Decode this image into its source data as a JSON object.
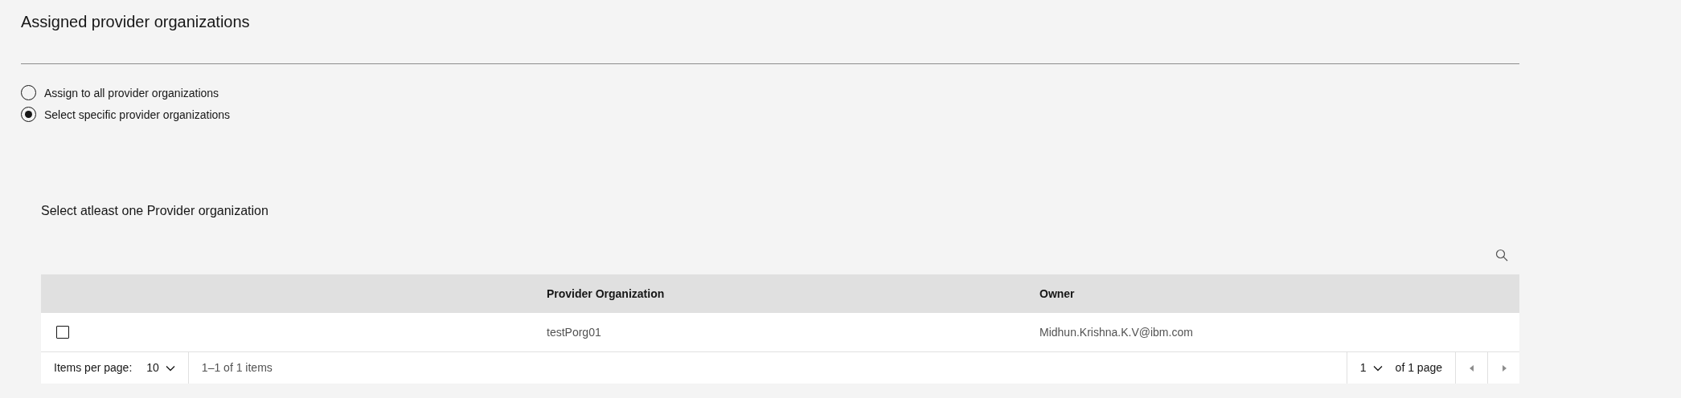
{
  "title": "Assigned provider organizations",
  "options": [
    {
      "label": "Assign to all provider organizations",
      "selected": false
    },
    {
      "label": "Select specific provider organizations",
      "selected": true
    }
  ],
  "section_title": "Select atleast one Provider organization",
  "table": {
    "columns": [
      "Provider Organization",
      "Owner"
    ],
    "rows": [
      {
        "checked": false,
        "cells": [
          "testPorg01",
          "Midhun.Krishna.K.V@ibm.com"
        ]
      }
    ]
  },
  "pagination": {
    "items_per_page_label": "Items per page:",
    "items_per_page": "10",
    "range": "1–1 of 1 items",
    "page": "1",
    "of_pages": "of 1 page"
  }
}
